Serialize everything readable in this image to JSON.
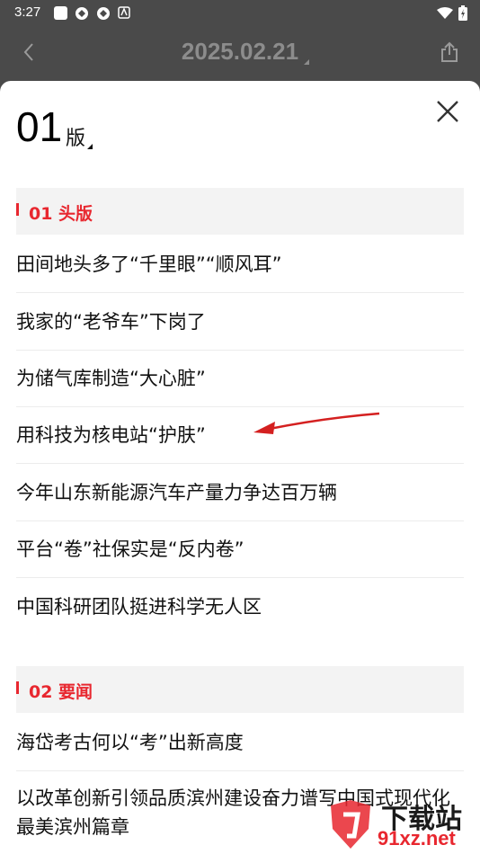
{
  "status_bar": {
    "time": "3:27"
  },
  "header": {
    "date": "2025.02.21"
  },
  "edition": {
    "number": "01",
    "suffix": "版"
  },
  "sections": [
    {
      "label": "01 头版",
      "articles": [
        "田间地头多了“千里眼”“顺风耳”",
        "我家的“老爷车”下岗了",
        "为储气库制造“大心脏”",
        "用科技为核电站“护肤”",
        "今年山东新能源汽车产量力争达百万辆",
        "平台“卷”社保实是“反内卷”",
        "中国科研团队挺进科学无人区"
      ]
    },
    {
      "label": "02 要闻",
      "articles": [
        "海岱考古何以“考”出新高度",
        "以改革创新引领品质滨州建设奋力谱写中国式现代化最美滨州篇章"
      ]
    }
  ],
  "watermark": {
    "text": "下载站",
    "url": "91xz.net"
  },
  "colors": {
    "accent": "#e8272f",
    "header_bg": "#4a4a4a"
  }
}
